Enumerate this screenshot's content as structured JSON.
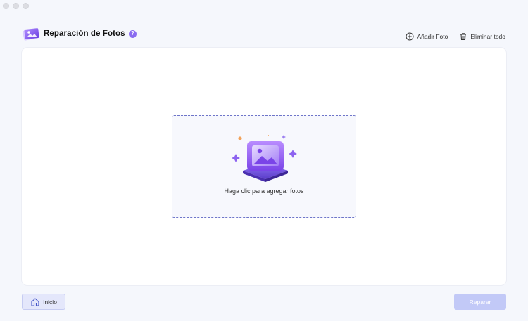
{
  "header": {
    "title": "Reparación de Fotos",
    "help_icon": "question-icon",
    "help_glyph": "?",
    "actions": {
      "add_photo": "Añadir Foto",
      "delete_all": "Eliminar todo"
    }
  },
  "dropzone": {
    "prompt": "Haga clic para agregar fotos"
  },
  "footer": {
    "home_label": "Inicio",
    "repair_label": "Reparar"
  },
  "colors": {
    "accent": "#7b5cf0",
    "dropzone_border": "#6e75c9",
    "repair_disabled": "#c2c9f7"
  }
}
